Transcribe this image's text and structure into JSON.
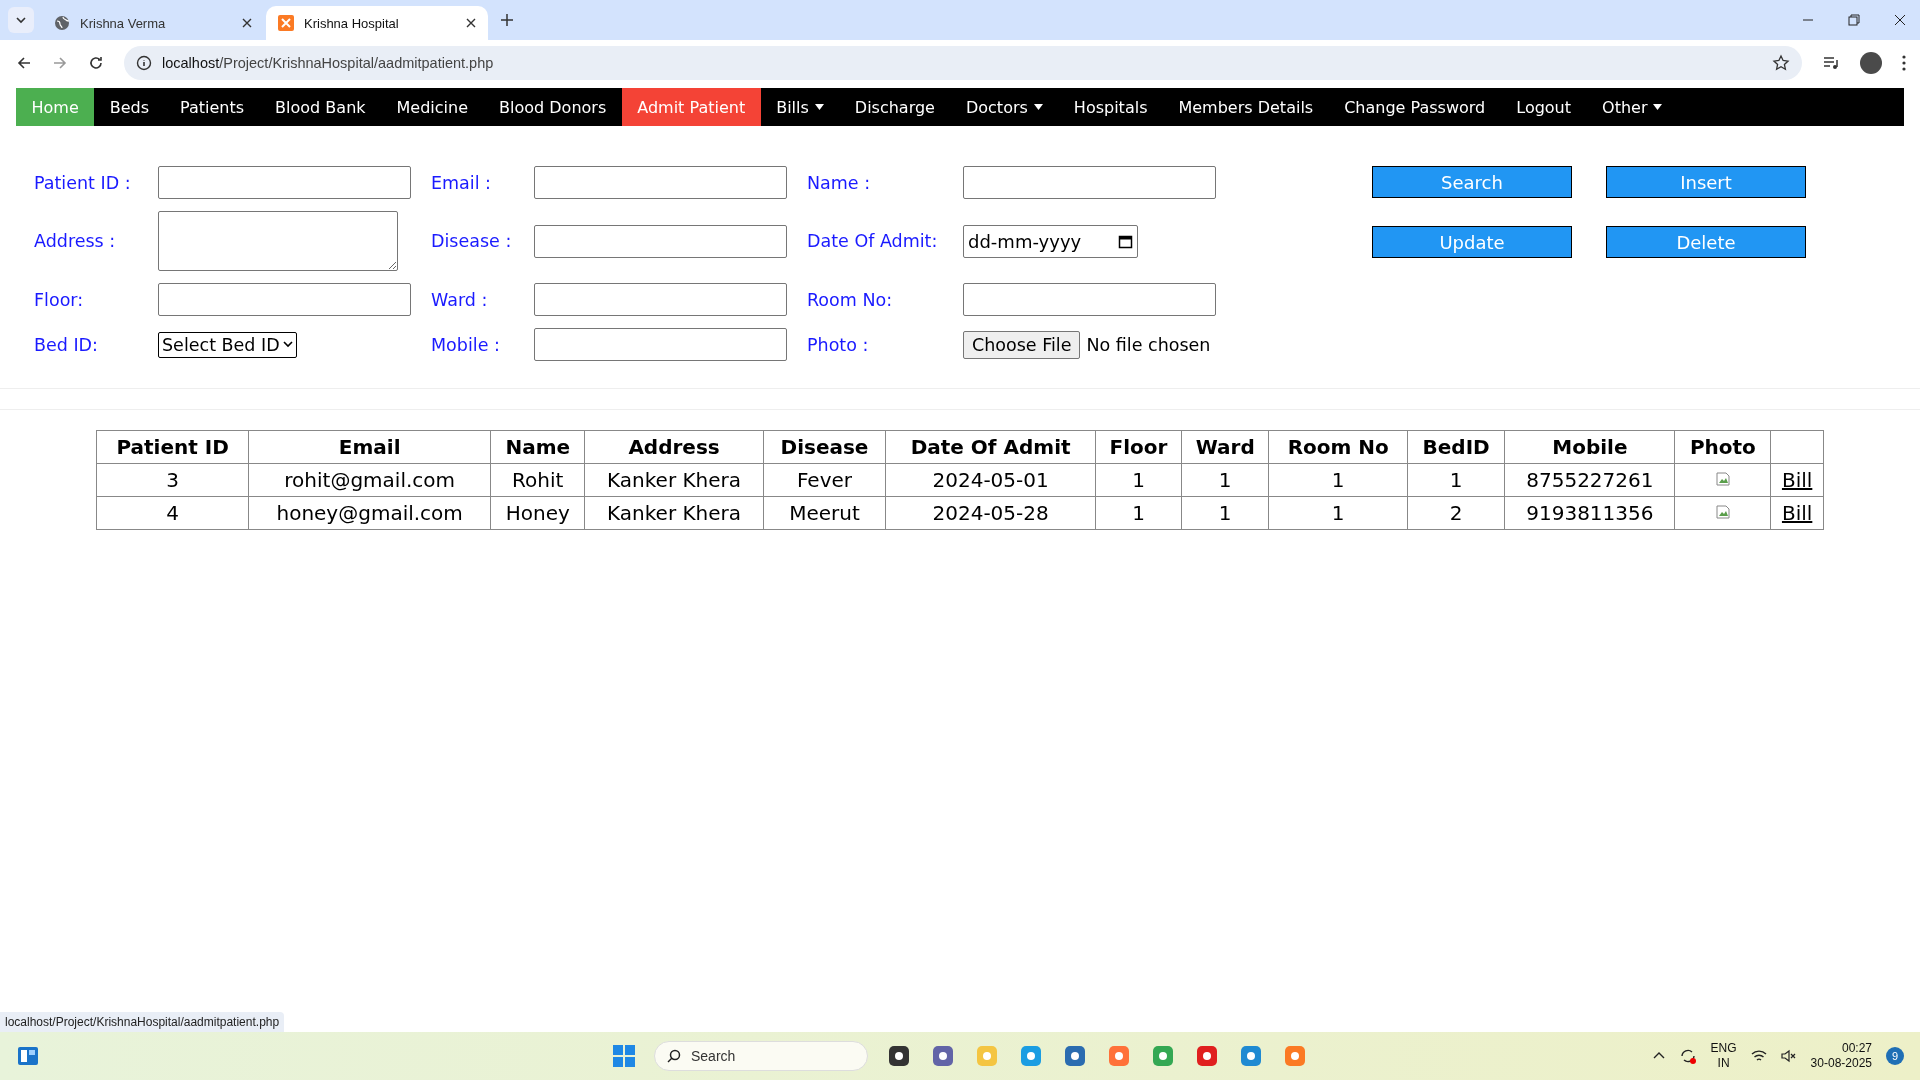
{
  "browser": {
    "tabs": [
      {
        "title": "Krishna Verma",
        "selected": false,
        "kind": "web"
      },
      {
        "title": "Krishna Hospital",
        "selected": true,
        "kind": "app"
      }
    ],
    "url_host": "localhost",
    "url_path": "/Project/KrishnaHospital/aadmitpatient.php",
    "status_url": "localhost/Project/KrishnaHospital/aadmitpatient.php"
  },
  "nav": {
    "items": [
      {
        "label": "Home",
        "kind": "home",
        "selected": false
      },
      {
        "label": "Beds",
        "kind": "link",
        "selected": false
      },
      {
        "label": "Patients",
        "kind": "link",
        "selected": false
      },
      {
        "label": "Blood Bank",
        "kind": "link",
        "selected": false
      },
      {
        "label": "Medicine",
        "kind": "link",
        "selected": false
      },
      {
        "label": "Blood Donors",
        "kind": "link",
        "selected": false
      },
      {
        "label": "Admit Patient",
        "kind": "link",
        "selected": true
      },
      {
        "label": "Bills",
        "kind": "dropdown",
        "selected": false
      },
      {
        "label": "Discharge",
        "kind": "link",
        "selected": false
      },
      {
        "label": "Doctors",
        "kind": "dropdown",
        "selected": false
      },
      {
        "label": "Hospitals",
        "kind": "link",
        "selected": false
      },
      {
        "label": "Members Details",
        "kind": "link",
        "selected": false
      },
      {
        "label": "Change Password",
        "kind": "link",
        "selected": false
      },
      {
        "label": "Logout",
        "kind": "link",
        "selected": false
      },
      {
        "label": "Other",
        "kind": "dropdown",
        "selected": false
      }
    ]
  },
  "form": {
    "fields": [
      {
        "label": "Patient ID :",
        "kind": "text"
      },
      {
        "label": "Email :",
        "kind": "text"
      },
      {
        "label": "Name :",
        "kind": "text"
      },
      {
        "label": "Address :",
        "kind": "textarea"
      },
      {
        "label": "Disease :",
        "kind": "text"
      },
      {
        "label": "Date Of Admit:",
        "kind": "date",
        "placeholder": "dd-mm-yyyy"
      },
      {
        "label": "Floor:",
        "kind": "text"
      },
      {
        "label": "Ward :",
        "kind": "text"
      },
      {
        "label": "Room No:",
        "kind": "text"
      },
      {
        "label": "Bed ID:",
        "kind": "select",
        "value": "Select Bed ID"
      },
      {
        "label": "Mobile :",
        "kind": "text"
      },
      {
        "label": "Photo :",
        "kind": "file",
        "button": "Choose File",
        "status": "No file chosen"
      }
    ],
    "buttons": [
      "Search",
      "Insert",
      "Update",
      "Delete"
    ]
  },
  "table": {
    "columns": [
      "Patient ID",
      "Email",
      "Name",
      "Address",
      "Disease",
      "Date Of Admit",
      "Floor",
      "Ward",
      "Room No",
      "BedID",
      "Mobile",
      "Photo"
    ],
    "rows": [
      {
        "cells": [
          "3",
          "rohit@gmail.com",
          "Rohit",
          "Kanker Khera",
          "Fever",
          "2024-05-01",
          "1",
          "1",
          "1",
          "1",
          "8755227261"
        ],
        "link": "Bill"
      },
      {
        "cells": [
          "4",
          "honey@gmail.com",
          "Honey",
          "Kanker Khera",
          "Meerut",
          "2024-05-28",
          "1",
          "1",
          "1",
          "2",
          "9193811356"
        ],
        "link": "Bill"
      }
    ]
  },
  "taskbar": {
    "search_placeholder": "Search",
    "language": "ENG",
    "region": "IN",
    "time": "00:27",
    "date": "30-08-2025",
    "notifications": "9"
  }
}
